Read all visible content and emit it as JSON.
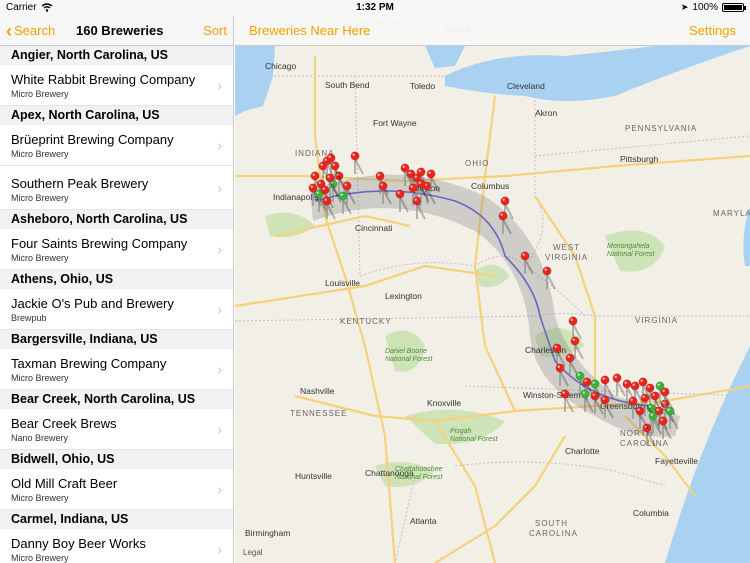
{
  "status": {
    "carrier": "Carrier",
    "time": "1:32 PM",
    "battery": "100%"
  },
  "master": {
    "back_label": "Search",
    "title": "160 Breweries",
    "sort_label": "Sort"
  },
  "sections": [
    {
      "header": "Angier, North Carolina, US",
      "items": [
        {
          "name": "White Rabbit Brewing Company",
          "type": "Micro Brewery"
        }
      ]
    },
    {
      "header": "Apex, North Carolina, US",
      "items": [
        {
          "name": "Brüeprint Brewing Company",
          "type": "Micro Brewery"
        },
        {
          "name": "Southern Peak Brewery",
          "type": "Micro Brewery"
        }
      ]
    },
    {
      "header": "Asheboro, North Carolina, US",
      "items": [
        {
          "name": "Four Saints Brewing Company",
          "type": "Micro Brewery"
        }
      ]
    },
    {
      "header": "Athens, Ohio, US",
      "items": [
        {
          "name": "Jackie O's Pub and Brewery",
          "type": "Brewpub"
        }
      ]
    },
    {
      "header": "Bargersville, Indiana, US",
      "items": [
        {
          "name": "Taxman Brewing Company",
          "type": "Micro Brewery"
        }
      ]
    },
    {
      "header": "Bear Creek, North Carolina, US",
      "items": [
        {
          "name": "Bear Creek Brews",
          "type": "Nano Brewery"
        }
      ]
    },
    {
      "header": "Bidwell, Ohio, US",
      "items": [
        {
          "name": "Old Mill Craft Beer",
          "type": "Micro Brewery"
        }
      ]
    },
    {
      "header": "Carmel, Indiana, US",
      "items": [
        {
          "name": "Danny Boy Beer Works",
          "type": "Micro Brewery"
        }
      ]
    }
  ],
  "detail": {
    "near_label": "Breweries Near Here",
    "settings_label": "Settings",
    "legal": "Legal"
  },
  "map": {
    "states": [
      "MICHIGAN",
      "OHIO",
      "INDIANA",
      "PENNSYLVANIA",
      "WEST VIRGINIA",
      "KENTUCKY",
      "VIRGINIA",
      "TENNESSEE",
      "NORTH CAROLINA",
      "SOUTH CAROLINA",
      "MARYLAND"
    ],
    "cities": [
      "Chicago",
      "Detroit",
      "South Bend",
      "Toledo",
      "Cleveland",
      "Akron",
      "Fort Wayne",
      "Pittsburgh",
      "Columbus",
      "Indianapolis",
      "Dayton",
      "Cincinnati",
      "Louisville",
      "Lexington",
      "Nashville",
      "Knoxville",
      "Winston-Salem",
      "Charlotte",
      "Chattanooga",
      "Huntsville",
      "Atlanta",
      "Birmingham",
      "Columbia",
      "Fayetteville",
      "Greensboro",
      "Charleston"
    ],
    "forests": [
      "Monongahela National Forest",
      "Daniel Boone National Forest",
      "Pisgah National Forest",
      "Chattahoochee National Forest"
    ],
    "colors": {
      "land": "#f2efe6",
      "water": "#a9d1f2",
      "park": "#cfe3b8",
      "interstate": "#f5d27a",
      "route": "#6a66c2",
      "pin_red": "#e8261f",
      "pin_green": "#3bb33b"
    }
  }
}
